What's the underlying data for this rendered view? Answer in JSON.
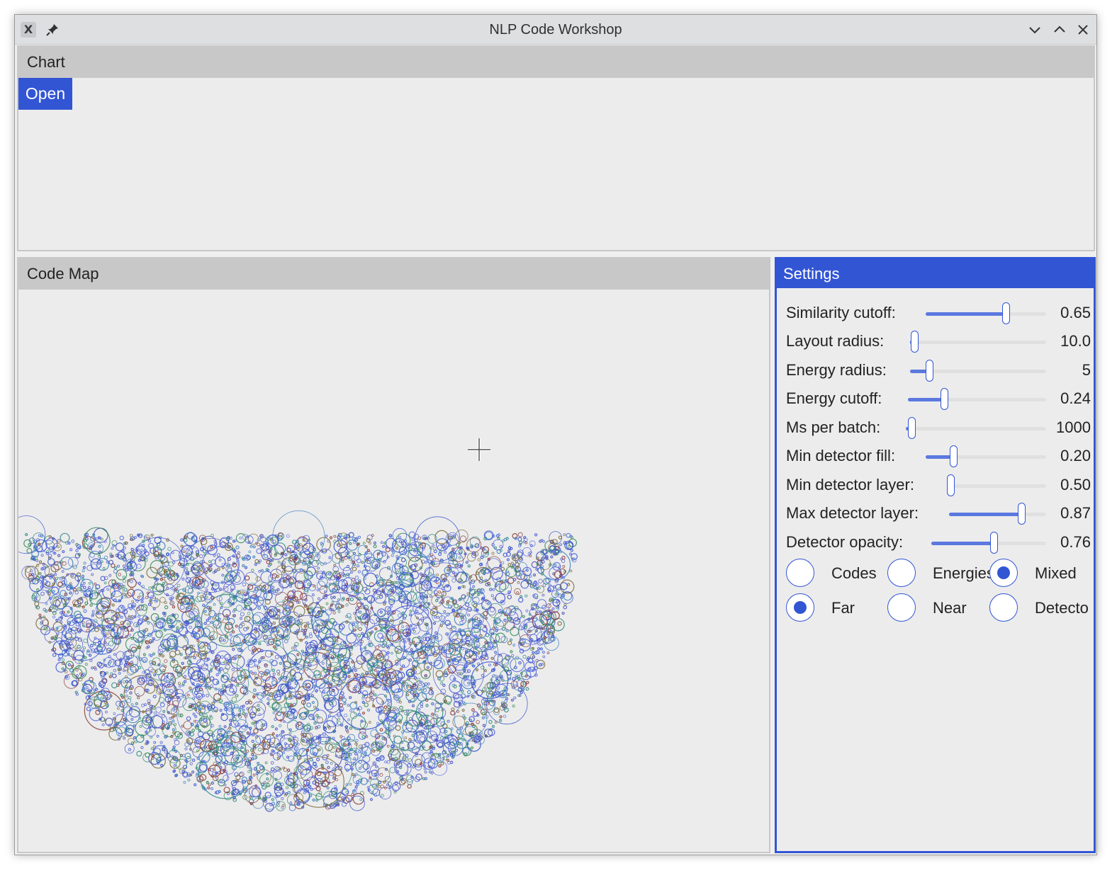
{
  "window": {
    "title": "NLP Code Workshop"
  },
  "chart_panel": {
    "header": "Chart",
    "open_label": "Open"
  },
  "code_map": {
    "header": "Code Map"
  },
  "settings": {
    "header": "Settings",
    "sliders": [
      {
        "label": "Similarity cutoff:",
        "value": "0.65",
        "level": 0.65
      },
      {
        "label": "Layout radius:",
        "value": "10.0",
        "level": 0.02
      },
      {
        "label": "Energy radius:",
        "value": "5",
        "level": 0.13
      },
      {
        "label": "Energy cutoff:",
        "value": "0.24",
        "level": 0.25
      },
      {
        "label": "Ms per batch:",
        "value": "1000",
        "level": 0.03
      },
      {
        "label": "Min detector fill:",
        "value": "0.20",
        "level": 0.22
      },
      {
        "label": "Min detector layer:",
        "value": "0.50",
        "level": 0.0
      },
      {
        "label": "Max detector layer:",
        "value": "0.87",
        "level": 0.73
      },
      {
        "label": "Detector opacity:",
        "value": "0.76",
        "level": 0.53
      }
    ],
    "view_options": [
      {
        "label": "Codes",
        "checked": false
      },
      {
        "label": "Energies",
        "checked": false
      },
      {
        "label": "Mixed",
        "checked": true
      }
    ],
    "distance_options": [
      {
        "label": "Far",
        "checked": true
      },
      {
        "label": "Near",
        "checked": false
      },
      {
        "label": "Detecto",
        "checked": false
      }
    ]
  },
  "colors": {
    "accent": "#3255d4",
    "panel_header": "#c8c8c8",
    "background": "#ececec"
  }
}
